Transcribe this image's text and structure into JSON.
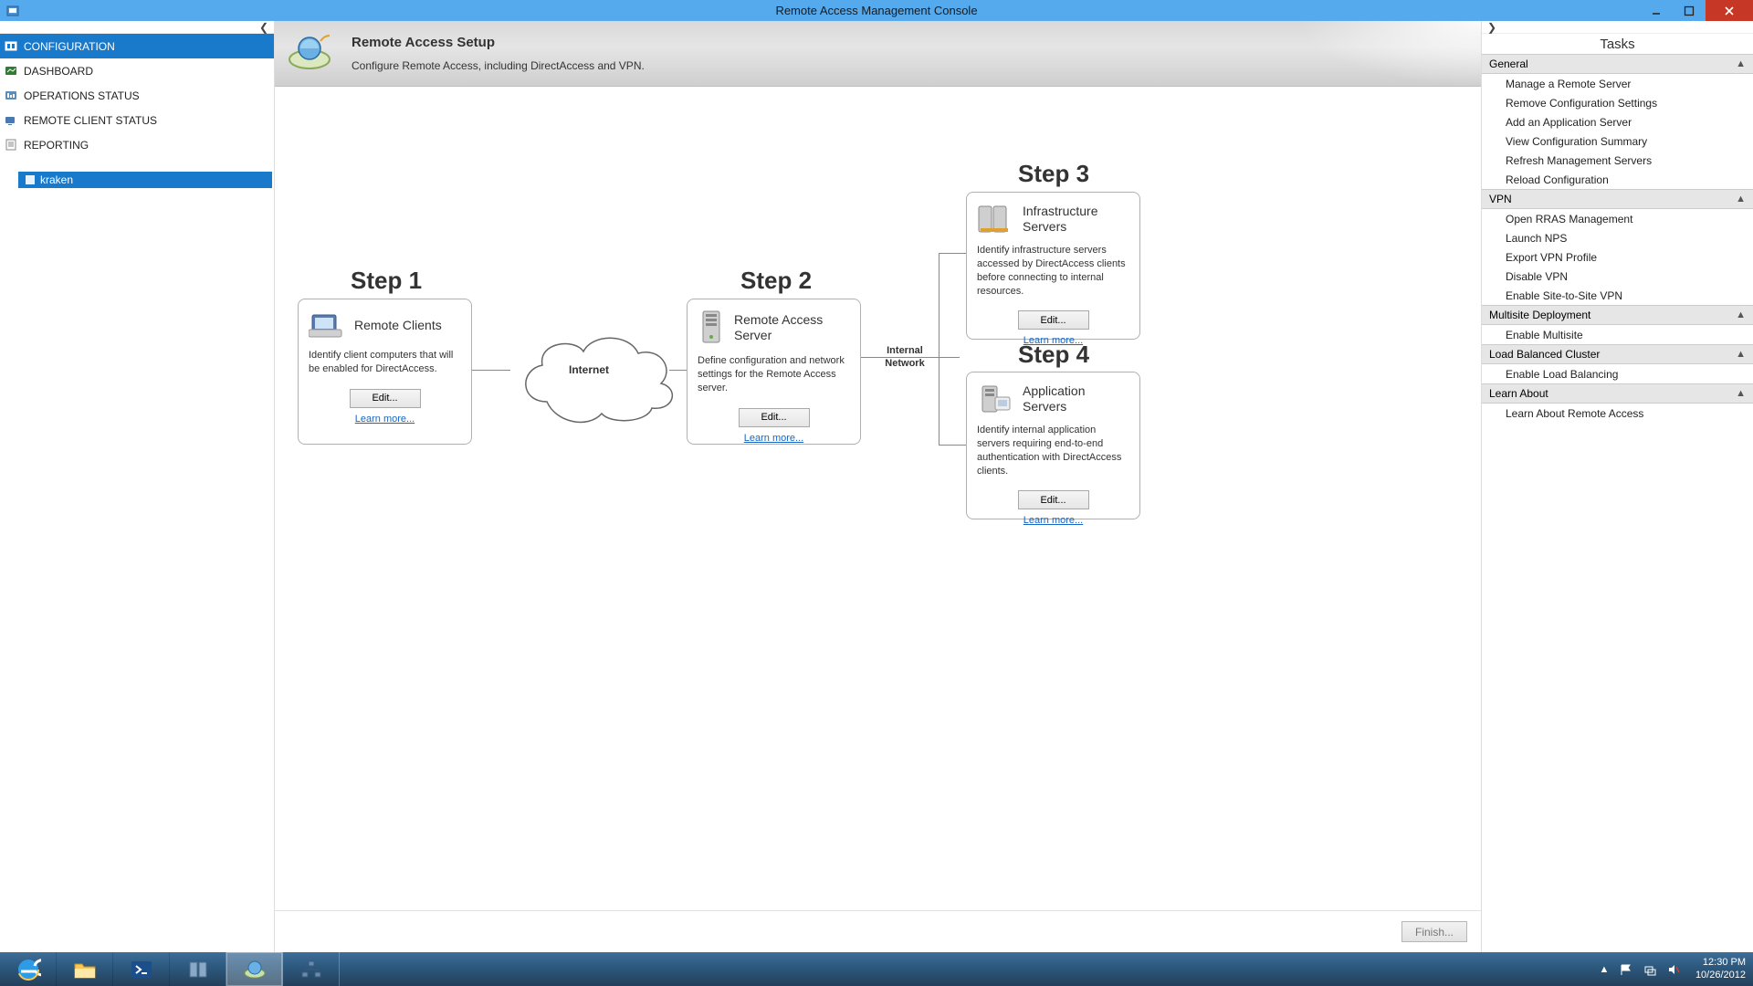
{
  "window": {
    "title": "Remote Access Management Console"
  },
  "nav": {
    "items": [
      {
        "label": "CONFIGURATION"
      },
      {
        "label": "DASHBOARD"
      },
      {
        "label": "OPERATIONS STATUS"
      },
      {
        "label": "REMOTE CLIENT STATUS"
      },
      {
        "label": "REPORTING"
      }
    ],
    "sub_item": "kraken"
  },
  "banner": {
    "title": "Remote Access Setup",
    "subtitle": "Configure Remote Access, including DirectAccess and VPN."
  },
  "steps": {
    "s1": {
      "heading": "Step 1",
      "title": "Remote Clients",
      "desc": "Identify client computers that will be enabled for DirectAccess.",
      "edit": "Edit...",
      "learn": "Learn more..."
    },
    "s2": {
      "heading": "Step 2",
      "title": "Remote Access Server",
      "desc": "Define configuration and network settings for the Remote Access server.",
      "edit": "Edit...",
      "learn": "Learn more..."
    },
    "s3": {
      "heading": "Step 3",
      "title": "Infrastructure Servers",
      "desc": "Identify infrastructure servers accessed by DirectAccess clients before connecting to internal resources.",
      "edit": "Edit...",
      "learn": "Learn more..."
    },
    "s4": {
      "heading": "Step 4",
      "title": "Application Servers",
      "desc": "Identify internal application servers requiring end-to-end authentication with DirectAccess clients.",
      "edit": "Edit...",
      "learn": "Learn more..."
    },
    "internet_label": "Internet",
    "internal_label_1": "Internal",
    "internal_label_2": "Network"
  },
  "footer": {
    "finish": "Finish..."
  },
  "tasks": {
    "title": "Tasks",
    "groups": [
      {
        "name": "General",
        "items": [
          "Manage a Remote Server",
          "Remove Configuration Settings",
          "Add an Application Server",
          "View Configuration Summary",
          "Refresh Management Servers",
          "Reload Configuration"
        ]
      },
      {
        "name": "VPN",
        "items": [
          "Open RRAS Management",
          "Launch NPS",
          "Export VPN Profile",
          "Disable VPN",
          "Enable Site-to-Site VPN"
        ]
      },
      {
        "name": "Multisite Deployment",
        "items": [
          "Enable Multisite"
        ]
      },
      {
        "name": "Load Balanced Cluster",
        "items": [
          "Enable Load Balancing"
        ]
      },
      {
        "name": "Learn About",
        "items": [
          "Learn About Remote Access"
        ]
      }
    ]
  },
  "tray": {
    "time": "12:30 PM",
    "date": "10/26/2012"
  }
}
